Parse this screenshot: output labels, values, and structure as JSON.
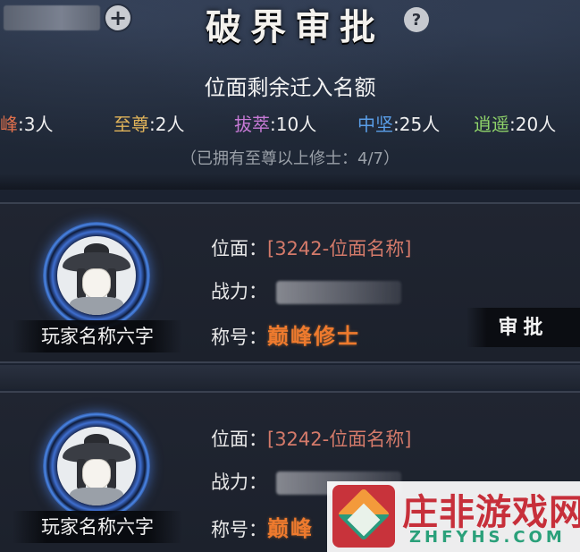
{
  "header": {
    "title": "破界审批",
    "add_icon": "plus-icon",
    "help_icon": "question-icon",
    "add_glyph": "+",
    "help_glyph": "?"
  },
  "quota": {
    "heading": "位面剩余迁入名额",
    "items": [
      {
        "label": "巅峰",
        "value": "3人",
        "color": "#e0704c"
      },
      {
        "label": "至尊",
        "value": "2人",
        "color": "#e0b35a"
      },
      {
        "label": "拔萃",
        "value": "10人",
        "color": "#c77ad6"
      },
      {
        "label": "中坚",
        "value": "25人",
        "color": "#5a9ee8"
      },
      {
        "label": "逍遥",
        "value": "20人",
        "color": "#8fd46a"
      }
    ],
    "separator": ":",
    "note": "（已拥有至尊以上修士：4/7）"
  },
  "applicants": [
    {
      "name": "玩家名称六字",
      "realm_label": "位面：",
      "realm_value": "[3242-位面名称]",
      "power_label": "战力：",
      "title_label": "称号：",
      "title_value": "巅峰修士",
      "approve_label": "审批"
    },
    {
      "name": "玩家名称六字",
      "realm_label": "位面：",
      "realm_value": "[3242-位面名称]",
      "power_label": "战力：",
      "title_label": "称号：",
      "title_value": "巅峰"
    }
  ],
  "watermark": {
    "brand": "庄非游戏网",
    "domain": "ZHFYHS.COM"
  }
}
